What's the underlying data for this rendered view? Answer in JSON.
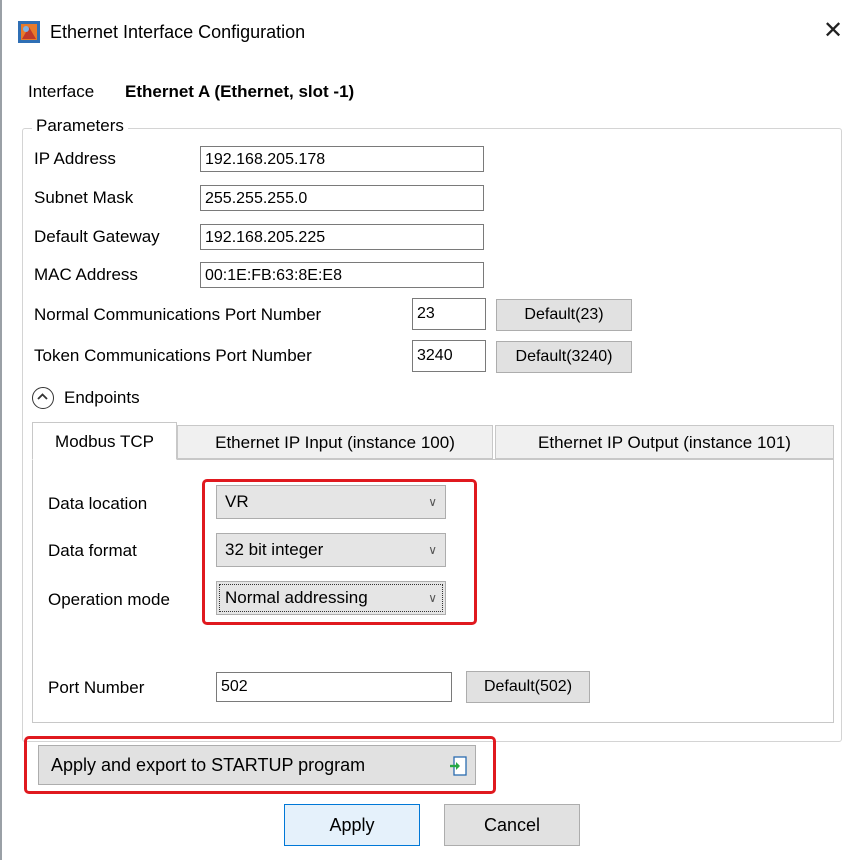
{
  "window": {
    "title": "Ethernet Interface Configuration",
    "close_glyph": "✕"
  },
  "interface": {
    "label": "Interface",
    "value": "Ethernet A (Ethernet, slot -1)"
  },
  "parameters": {
    "group_title": "Parameters",
    "ip_address": {
      "label": "IP Address",
      "value": "192.168.205.178"
    },
    "subnet_mask": {
      "label": "Subnet Mask",
      "value": "255.255.255.0"
    },
    "default_gateway": {
      "label": "Default Gateway",
      "value": "192.168.205.225"
    },
    "mac_address": {
      "label": "MAC Address",
      "value": "00:1E:FB:63:8E:E8"
    },
    "normal_port": {
      "label": "Normal Communications Port Number",
      "value": "23",
      "default_label": "Default(23)"
    },
    "token_port": {
      "label": "Token Communications Port Number",
      "value": "3240",
      "default_label": "Default(3240)"
    }
  },
  "endpoints": {
    "label": "Endpoints",
    "tabs": [
      "Modbus TCP",
      "Ethernet IP Input (instance 100)",
      "Ethernet IP Output (instance 101)"
    ],
    "active_tab": "Modbus TCP",
    "modbus": {
      "data_location": {
        "label": "Data location",
        "value": "VR"
      },
      "data_format": {
        "label": "Data format",
        "value": "32 bit integer"
      },
      "operation_mode": {
        "label": "Operation mode",
        "value": "Normal addressing"
      },
      "port_number": {
        "label": "Port Number",
        "value": "502",
        "default_label": "Default(502)"
      }
    }
  },
  "actions": {
    "export_label": "Apply and export to STARTUP program",
    "apply_label": "Apply",
    "cancel_label": "Cancel"
  },
  "colors": {
    "highlight_red": "#e0191f",
    "focus_blue": "#0078d7"
  },
  "icons": {
    "app": "app-icon",
    "close": "close-icon",
    "collapse": "chevron-up-circle-icon",
    "export": "export-arrow-icon",
    "dropdown": "chevron-down-icon"
  }
}
